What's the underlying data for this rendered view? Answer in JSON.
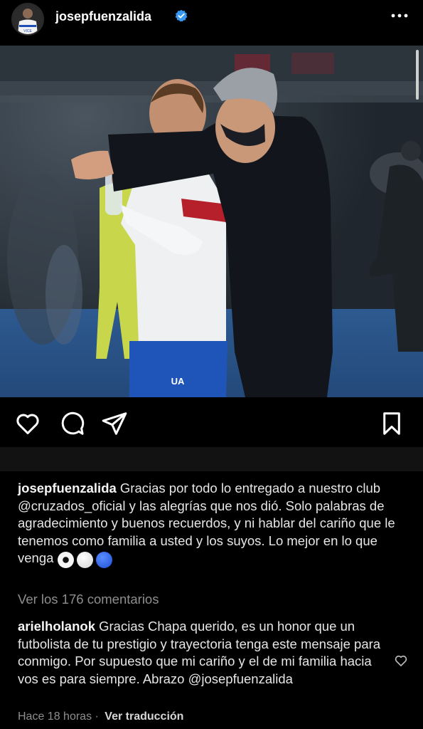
{
  "header": {
    "username": "josepfuenzalida",
    "verified": true,
    "more_icon": "more-horizontal-icon",
    "avatar_jersey_text": "VICE"
  },
  "post": {
    "image": "photo of a coach speaking to a player at a football match",
    "player_shorts_logo": "UA"
  },
  "actions": {
    "icons": [
      "heart-icon",
      "comment-icon",
      "share-icon",
      "bookmark-icon"
    ]
  },
  "caption": {
    "username": "josepfuenzalida",
    "text": "Gracias por todo lo entregado a nuestro club @cruzados_oficial y las alegrías que nos dió. Solo palabras de agradecimiento y buenos recuerdos, y ni hablar del cariño que le tenemos como familia a usted y los suyos. Lo mejor en lo que venga",
    "emojis": [
      "soccer-ball",
      "white-circle",
      "blue-circle"
    ]
  },
  "view_comments": "Ver los 176 comentarios",
  "comment": {
    "username": "arielholanok",
    "text": "Gracias Chapa querido, es un honor que un futbolista de tu prestigio y trayectoria tenga este mensaje para conmigo. Por supuesto que mi cariño y el de mi familia hacia vos es para siempre. Abrazo @josepfuenzalida",
    "time": "Hace 18 horas",
    "separator": "·",
    "translate": "Ver traducción"
  },
  "colors": {
    "background": "#000000",
    "text": "#f5f5f5",
    "muted": "#8e8e8e",
    "verified_blue": "#3897f0",
    "club_blue": "#1e4fb8"
  }
}
